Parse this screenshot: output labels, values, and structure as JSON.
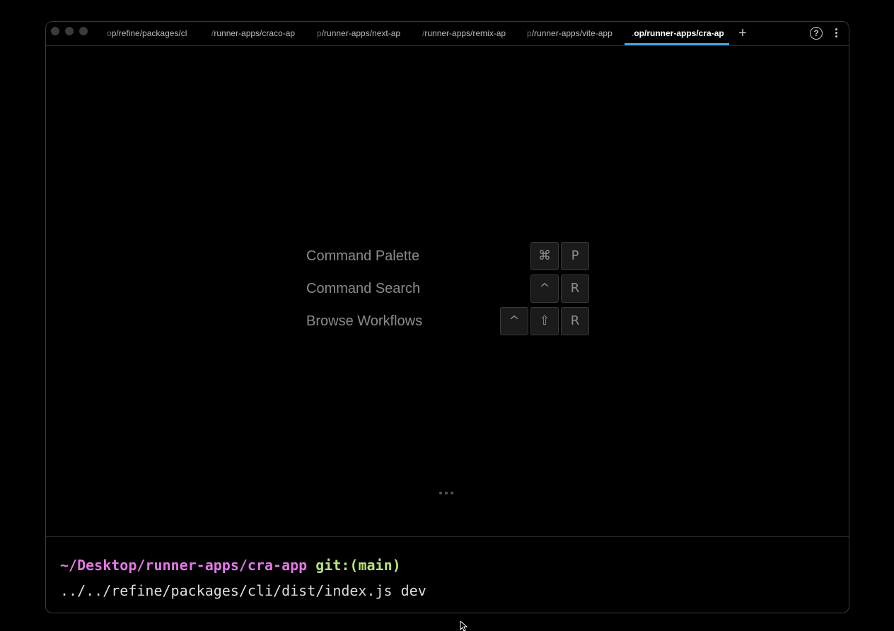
{
  "tabs": [
    {
      "fade": "o",
      "label": "p/refine/packages/cl",
      "active": false
    },
    {
      "fade": "/",
      "label": "runner-apps/craco-ap",
      "active": false
    },
    {
      "fade": "p",
      "label": "/runner-apps/next-ap",
      "active": false
    },
    {
      "fade": "/",
      "label": "runner-apps/remix-ap",
      "active": false
    },
    {
      "fade": "p",
      "label": "/runner-apps/vite-app",
      "active": false
    },
    {
      "fade": ".",
      "label": "op/runner-apps/cra-ap",
      "active": true
    }
  ],
  "toolbar": {
    "add_tab": "+",
    "help": "?"
  },
  "shortcuts": [
    {
      "label": "Command Palette",
      "keys": [
        "⌘",
        "P"
      ]
    },
    {
      "label": "Command Search",
      "keys": [
        "^",
        "R"
      ]
    },
    {
      "label": "Browse Workflows",
      "keys": [
        "^",
        "⇧",
        "R"
      ]
    }
  ],
  "terminal": {
    "path": "~/Desktop/runner-apps/cra-app",
    "git": "git:(main)",
    "command": "../../refine/packages/cli/dist/index.js dev"
  },
  "icons": {
    "add": "plus-icon",
    "help": "help-icon",
    "menu": "kebab-menu-icon",
    "cursor": "mouse-cursor-icon"
  },
  "colors": {
    "accent": "#4aa3df",
    "prompt_path": "#e378e6",
    "prompt_git": "#b7e27b"
  }
}
